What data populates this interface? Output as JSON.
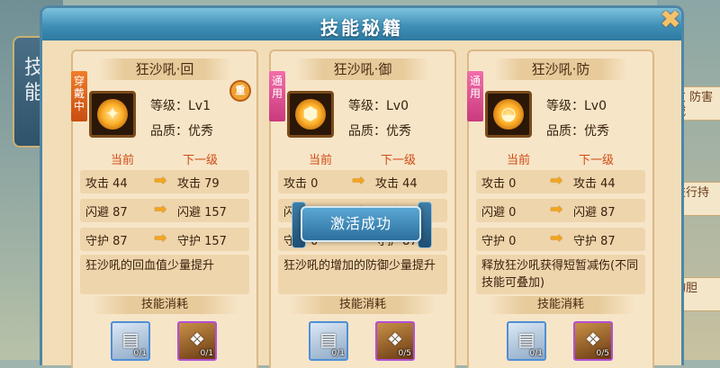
{
  "background": {
    "left_text": "技能",
    "right_cards": [
      "友\n防害减",
      "进行持",
      "物胆"
    ]
  },
  "dialog": {
    "title": "技能秘籍",
    "close_icon": "close-x-icon"
  },
  "cards": [
    {
      "name": "狂沙吼·回",
      "tag": "穿戴中",
      "tag_type": "equip",
      "badge": "重",
      "icon_glyph": "✦",
      "level": "等级：Lv1",
      "quality": "品质：优秀",
      "cur_label": "当前",
      "next_label": "下一级",
      "stats": [
        {
          "cur": "攻击 44",
          "next": "攻击 79"
        },
        {
          "cur": "闪避 87",
          "next": "闪避 157"
        },
        {
          "cur": "守护 87",
          "next": "守护 157"
        }
      ],
      "desc": "狂沙吼的回血值少量提升",
      "cost_label": "技能消耗",
      "items": [
        {
          "type": "blue",
          "icon": "scroll-icon",
          "count": "0/1"
        },
        {
          "type": "purple",
          "icon": "bag-icon",
          "count": "0/1"
        }
      ]
    },
    {
      "name": "狂沙吼·御",
      "tag": "通用",
      "tag_type": "general",
      "badge": "",
      "icon_glyph": "⬢",
      "level": "等级：Lv0",
      "quality": "品质：优秀",
      "cur_label": "当前",
      "next_label": "下一级",
      "stats": [
        {
          "cur": "攻击 0",
          "next": "攻击 44"
        },
        {
          "cur": "闪避 0",
          "next": "闪避 87"
        },
        {
          "cur": "守护 0",
          "next": "守护 87"
        }
      ],
      "desc": "狂沙吼的增加的防御少量提升",
      "cost_label": "技能消耗",
      "items": [
        {
          "type": "blue",
          "icon": "scroll-icon",
          "count": "0/1"
        },
        {
          "type": "purple",
          "icon": "bag-icon",
          "count": "0/5"
        }
      ]
    },
    {
      "name": "狂沙吼·防",
      "tag": "通用",
      "tag_type": "general",
      "badge": "",
      "icon_glyph": "◒",
      "level": "等级：Lv0",
      "quality": "品质：优秀",
      "cur_label": "当前",
      "next_label": "下一级",
      "stats": [
        {
          "cur": "攻击 0",
          "next": "攻击 44"
        },
        {
          "cur": "闪避 0",
          "next": "闪避 87"
        },
        {
          "cur": "守护 0",
          "next": "守护 87"
        }
      ],
      "desc": "释放狂沙吼获得短暂减伤(不同技能可叠加)",
      "cost_label": "技能消耗",
      "items": [
        {
          "type": "blue",
          "icon": "scroll-icon",
          "count": "0/1"
        },
        {
          "type": "purple",
          "icon": "bag-icon",
          "count": "0/5"
        }
      ]
    }
  ],
  "toast": "激活成功",
  "colors": {
    "title_bar": "#3f8fb6",
    "panel_bg": "#f2ddb9",
    "accent_orange": "#d04a14"
  }
}
